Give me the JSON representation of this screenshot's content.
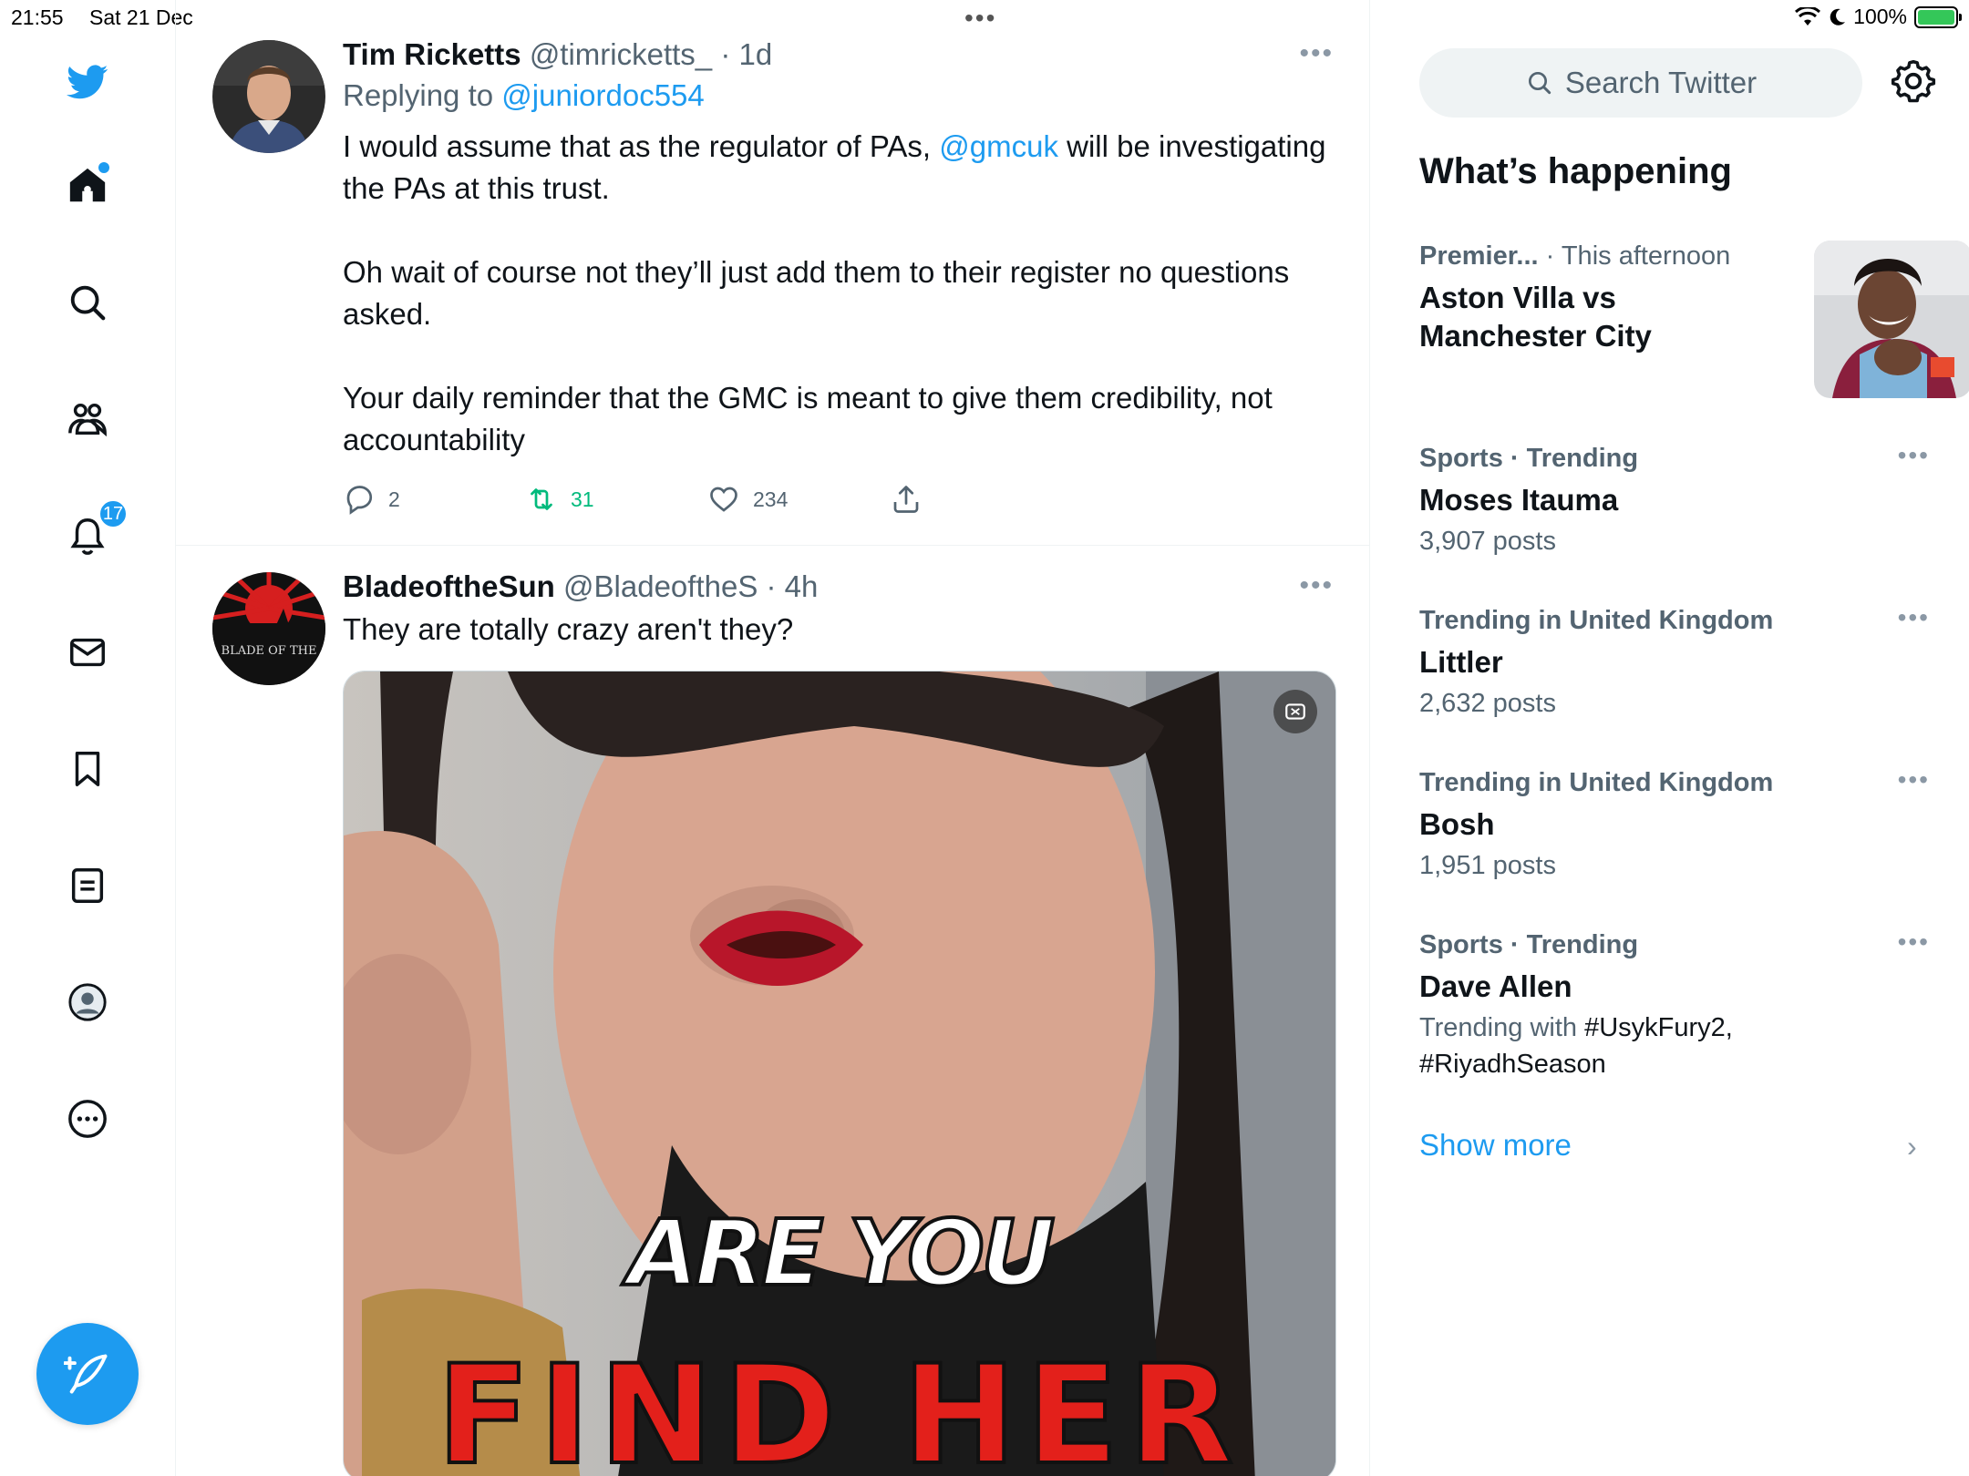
{
  "status_bar": {
    "time": "21:55",
    "date": "Sat 21 Dec",
    "battery": "100%",
    "battery_level": 1.0
  },
  "nav": {
    "notifications_badge": "17",
    "icons": [
      "twitter-logo-icon",
      "home-icon",
      "search-icon",
      "communities-icon",
      "notifications-icon",
      "messages-icon",
      "bookmarks-icon",
      "lists-icon",
      "profile-icon",
      "more-icon"
    ]
  },
  "tweets": [
    {
      "name": "Tim Ricketts",
      "handle": "@timricketts_",
      "time": "· 1d",
      "replying_prefix": "Replying to",
      "replying_to": "@juniordoc554",
      "text_p1_a": "I would assume that as the regulator of PAs,",
      "text_p1_mention": "@gmcuk",
      "text_p1_b": "will be investigating the PAs at this trust.",
      "text_p2": "Oh wait of course not they’ll just add them to their register no questions asked.",
      "text_p3": "Your daily reminder that the GMC is meant to give them credibility, not accountability",
      "replies": "2",
      "retweets": "31",
      "likes": "234"
    },
    {
      "name": "BladeoftheSun",
      "handle": "@BladeoftheS",
      "time": "· 4h",
      "text": "They are totally crazy aren't they?",
      "avatar_text": "BLADE OF THE",
      "media_caption_1": "ARE YOU",
      "media_caption_2": "FIND HER"
    }
  ],
  "sidebar": {
    "search_placeholder": "Search Twitter",
    "whats_happening": "What’s happening",
    "trends": [
      {
        "category": "Premier...",
        "meta_extra": "· This afternoon",
        "title_line1": "Aston Villa vs",
        "title_line2": "Manchester City"
      },
      {
        "category": "Sports · Trending",
        "title": "Moses Itauma",
        "count": "3,907 posts"
      },
      {
        "category": "Trending in United Kingdom",
        "title": "Littler",
        "count": "2,632 posts"
      },
      {
        "category": "Trending in United Kingdom",
        "title": "Bosh",
        "count": "1,951 posts"
      },
      {
        "category": "Sports · Trending",
        "title": "Dave Allen",
        "count_prefix": "Trending with",
        "tag1": "#UsykFury2,",
        "tag2": "#RiyadhSeason"
      }
    ],
    "show_more": "Show more"
  },
  "colors": {
    "accent": "#1d9bf0",
    "retweet": "#00ba7c",
    "secondary_text": "#536471"
  }
}
